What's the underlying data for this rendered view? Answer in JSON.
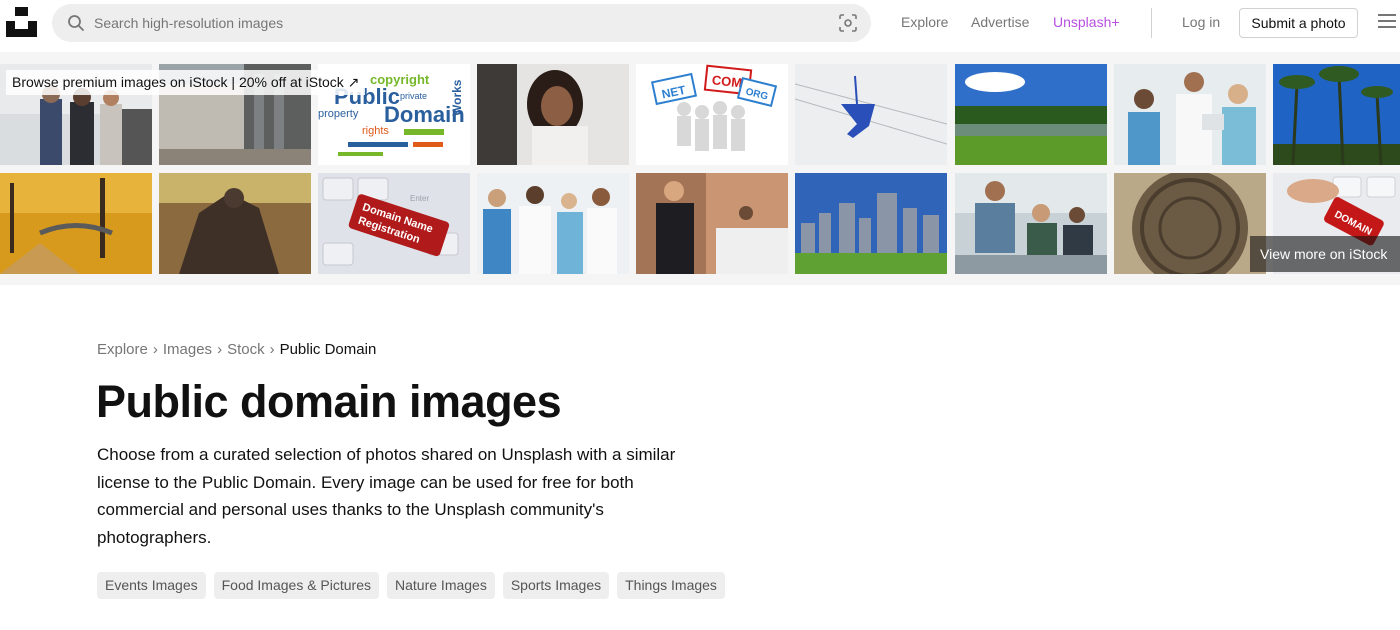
{
  "header": {
    "search_placeholder": "Search high-resolution images",
    "nav": {
      "explore": "Explore",
      "advertise": "Advertise",
      "unsplash_plus": "Unsplash+",
      "login": "Log in",
      "submit_photo": "Submit a photo"
    },
    "accent_color": "#b84fe0"
  },
  "istock": {
    "promo_text": "Browse premium images on iStock | 20% off at iStock ↗",
    "view_more": "View more on iStock ↗",
    "wordcloud": {
      "public": "Public",
      "domain": "Domain",
      "copyright": "copyright",
      "property": "property",
      "rights": "rights",
      "works": "Works",
      "private": "private"
    },
    "signs": [
      "NET",
      "COM",
      "ORG"
    ],
    "domain_key": [
      "Domain Name",
      "Registration"
    ],
    "domain_key_small": "DOMAIN",
    "enter_key": "Enter"
  },
  "content": {
    "breadcrumb": [
      "Explore",
      "Images",
      "Stock",
      "Public Domain"
    ],
    "breadcrumb_sep": "›",
    "title": "Public domain images",
    "description": "Choose from a curated selection of photos shared on Unsplash with a similar license to the Public Domain. Every image can be used for free for both commercial and personal uses thanks to the Unsplash community's photographers.",
    "tags": [
      "Events Images",
      "Food Images & Pictures",
      "Nature Images",
      "Sports Images",
      "Things Images"
    ]
  }
}
